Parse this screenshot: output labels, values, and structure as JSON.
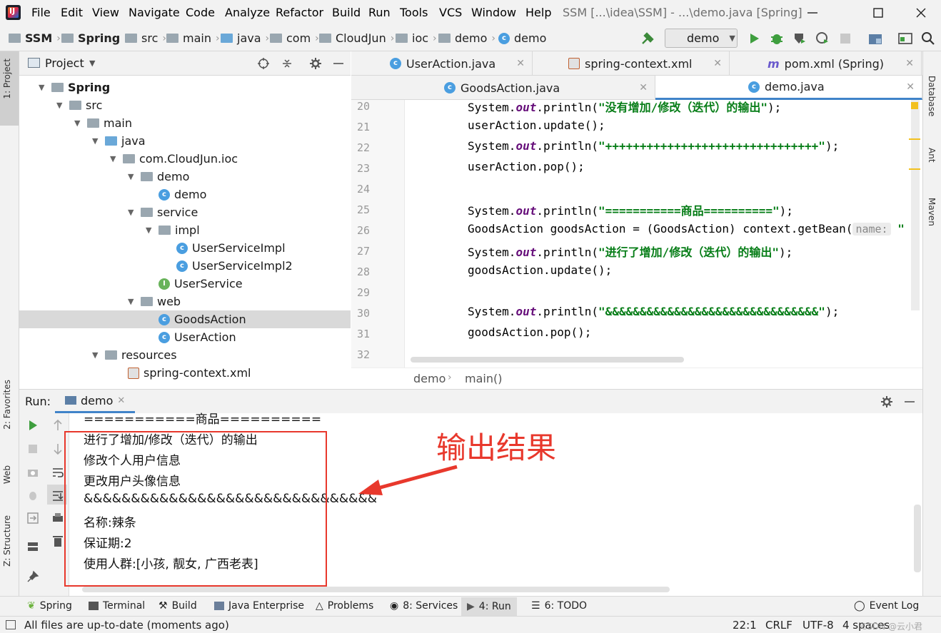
{
  "window": {
    "title": "SSM [...\\idea\\SSM] - ...\\demo.java [Spring]"
  },
  "menu": [
    "File",
    "Edit",
    "View",
    "Navigate",
    "Code",
    "Analyze",
    "Refactor",
    "Build",
    "Run",
    "Tools",
    "VCS",
    "Window",
    "Help"
  ],
  "breadcrumb": [
    "SSM",
    "Spring",
    "src",
    "main",
    "java",
    "com",
    "CloudJun",
    "ioc",
    "demo",
    "demo"
  ],
  "run_config": "demo",
  "left_tabs": {
    "project": "1: Project",
    "favorites": "2: Favorites",
    "web": "Web",
    "structure": "Z: Structure"
  },
  "right_tabs": {
    "database": "Database",
    "ant": "Ant",
    "maven": "Maven"
  },
  "project_panel": {
    "title": "Project"
  },
  "tree": [
    {
      "label": "Spring",
      "bold": true
    },
    {
      "label": "src"
    },
    {
      "label": "main"
    },
    {
      "label": "java"
    },
    {
      "label": "com.CloudJun.ioc"
    },
    {
      "label": "demo"
    },
    {
      "label": "demo"
    },
    {
      "label": "service"
    },
    {
      "label": "impl"
    },
    {
      "label": "UserServiceImpl"
    },
    {
      "label": "UserServiceImpl2"
    },
    {
      "label": "UserService"
    },
    {
      "label": "web"
    },
    {
      "label": "GoodsAction",
      "selected": true
    },
    {
      "label": "UserAction"
    },
    {
      "label": "resources"
    },
    {
      "label": "spring-context.xml"
    }
  ],
  "editor_tabs_row1": [
    "UserAction.java",
    "spring-context.xml",
    "pom.xml (Spring)"
  ],
  "editor_tabs_row2": [
    "GoodsAction.java",
    "demo.java"
  ],
  "active_tab": "demo.java",
  "code": {
    "line_numbers": [
      "20",
      "21",
      "22",
      "23",
      "24",
      "25",
      "26",
      "27",
      "28",
      "29",
      "30",
      "31",
      "32"
    ],
    "l20": {
      "pre": "System.",
      "kw": "out",
      "mid": ".println(",
      "str": "\"没有增加/修改（迭代）的输出\"",
      "post": ");"
    },
    "l21": "userAction.update();",
    "l22": {
      "pre": "System.",
      "kw": "out",
      "mid": ".println(",
      "str": "\"+++++++++++++++++++++++++++++++\"",
      "post": ");"
    },
    "l23": "userAction.pop();",
    "l25": {
      "pre": "System.",
      "kw": "out",
      "mid": ".println(",
      "str": "\"===========商品==========\"",
      "post": ");"
    },
    "l26": {
      "text": "GoodsAction goodsAction = (GoodsAction) context.getBean(",
      "hint": "name:",
      "post": " \""
    },
    "l27": {
      "pre": "System.",
      "kw": "out",
      "mid": ".println(",
      "str": "\"进行了增加/修改（迭代）的输出\"",
      "post": ");"
    },
    "l28": "goodsAction.update();",
    "l30": {
      "pre": "System.",
      "kw": "out",
      "mid": ".println(",
      "str": "\"&&&&&&&&&&&&&&&&&&&&&&&&&&&&&&&\"",
      "post": ");"
    },
    "l31": "goodsAction.pop();"
  },
  "editor_breadcrumb": [
    "demo",
    "main()"
  ],
  "run_panel": {
    "label": "Run:",
    "tab": "demo"
  },
  "console": [
    "===========商品==========",
    "进行了增加/修改（迭代）的输出",
    "修改个人用户信息",
    "更改用户头像信息",
    "&&&&&&&&&&&&&&&&&&&&&&&&&&&&&&&",
    "名称:辣条",
    "保证期:2",
    "使用人群:[小孩, 靓女, 广西老表]"
  ],
  "annotation": "输出结果",
  "bottom_tabs": [
    {
      "label": "Spring"
    },
    {
      "label": "Terminal"
    },
    {
      "label": "Build"
    },
    {
      "label": "Java Enterprise"
    },
    {
      "label": "Problems"
    },
    {
      "label": "8: Services"
    },
    {
      "label": "4: Run",
      "active": true
    },
    {
      "label": "6: TODO"
    }
  ],
  "event_log": "Event Log",
  "status": {
    "message": "All files are up-to-date (moments ago)",
    "position": "22:1",
    "line_sep": "CRLF",
    "encoding": "UTF-8",
    "indent": "4 spaces",
    "watermark": "CSDN @云小君"
  },
  "colors": {
    "accent": "#4083c9",
    "annotation": "#e8382c",
    "string": "#067d17",
    "keyword": "#660e7a"
  }
}
